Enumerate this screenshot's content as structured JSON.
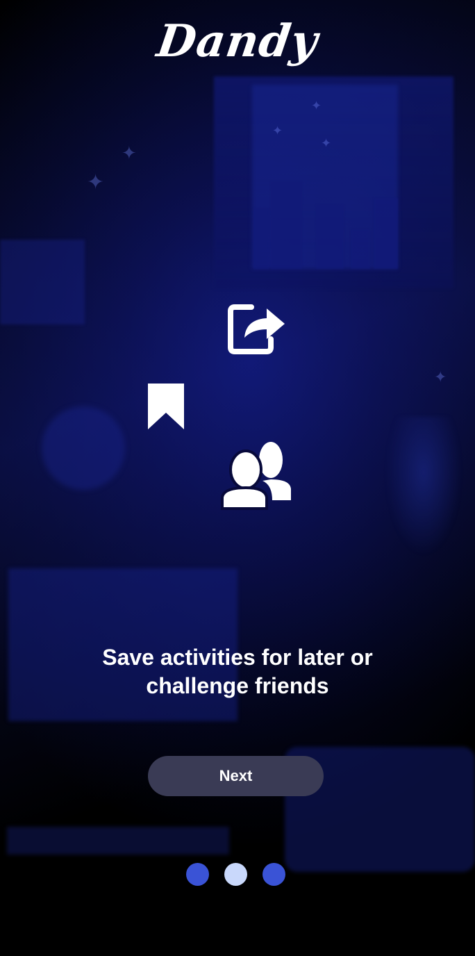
{
  "app": {
    "logo_text": "Dandy"
  },
  "onboarding": {
    "headline": "Save activities for later or challenge friends",
    "next_label": "Next",
    "page_count": 3,
    "active_page": 2,
    "icons": [
      "share-icon",
      "bookmark-icon",
      "friends-icon"
    ]
  },
  "colors": {
    "dot_inactive": "#3a53d6",
    "dot_active": "#c9d8fb",
    "button_bg": "#3a3b55"
  }
}
